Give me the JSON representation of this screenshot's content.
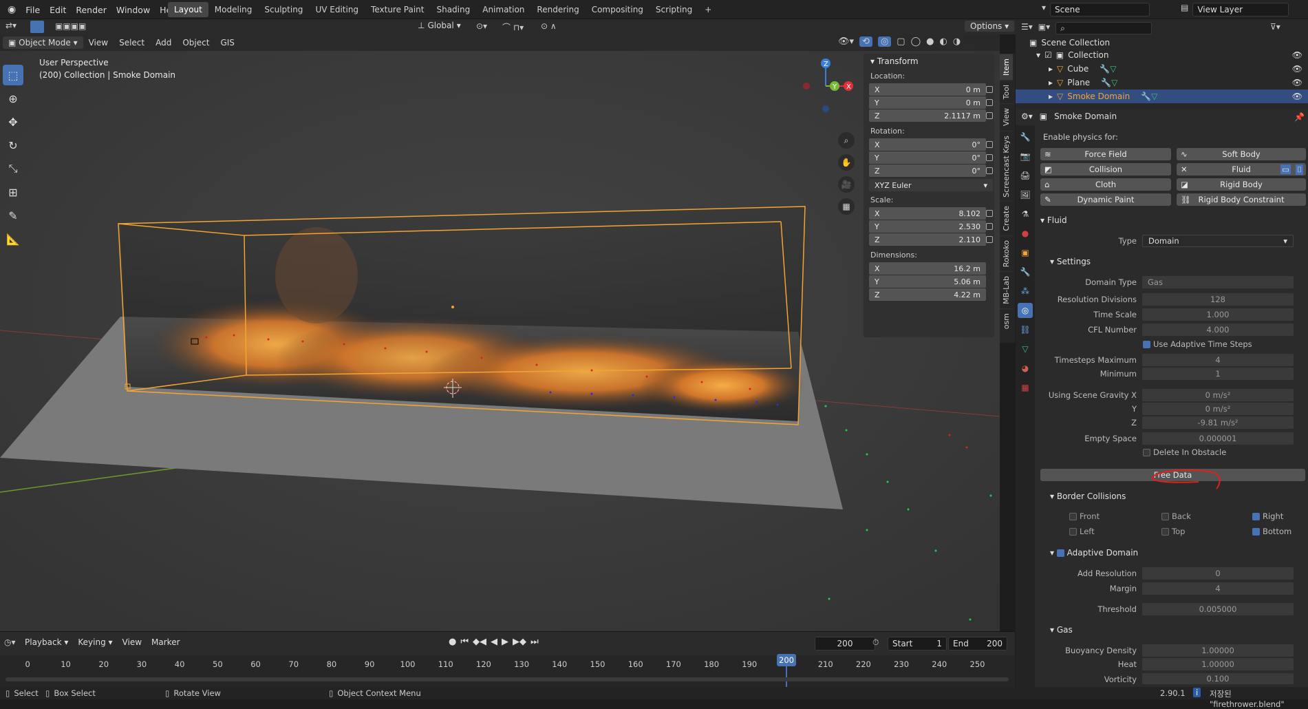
{
  "menu": {
    "file": "File",
    "edit": "Edit",
    "render": "Render",
    "window": "Window",
    "help": "Help"
  },
  "workspaces": [
    "Layout",
    "Modeling",
    "Sculpting",
    "UV Editing",
    "Texture Paint",
    "Shading",
    "Animation",
    "Rendering",
    "Compositing",
    "Scripting"
  ],
  "scene": {
    "name": "Scene",
    "view_layer": "View Layer"
  },
  "toolheader": {
    "orientation": "Global",
    "options": "Options"
  },
  "viewport_header": {
    "mode": "Object Mode",
    "view": "View",
    "select": "Select",
    "add": "Add",
    "object": "Object",
    "gis": "GIS"
  },
  "viewport": {
    "perspective": "User Perspective",
    "context": "(200) Collection | Smoke Domain"
  },
  "transform": {
    "title": "Transform",
    "location_label": "Location:",
    "loc_x": "0 m",
    "loc_y": "0 m",
    "loc_z": "2.1117 m",
    "rotation_label": "Rotation:",
    "rot_x": "0°",
    "rot_y": "0°",
    "rot_z": "0°",
    "rotation_mode": "XYZ Euler",
    "scale_label": "Scale:",
    "scale_x": "8.102",
    "scale_y": "2.530",
    "scale_z": "2.110",
    "dimensions_label": "Dimensions:",
    "dim_x": "16.2 m",
    "dim_y": "5.06 m",
    "dim_z": "4.22 m",
    "axis_x": "X",
    "axis_y": "Y",
    "axis_z": "Z"
  },
  "side_tabs": [
    "Item",
    "Tool",
    "View",
    "Screencast Keys",
    "Create",
    "Rokoko",
    "MB-Lab",
    "osm"
  ],
  "outliner": {
    "root": "Scene Collection",
    "collection": "Collection",
    "items": [
      "Cube",
      "Plane",
      "Smoke Domain"
    ]
  },
  "properties": {
    "object_name": "Smoke Domain",
    "enable_physics": "Enable physics for:",
    "physics_buttons": [
      "Force Field",
      "Soft Body",
      "Collision",
      "Fluid",
      "Cloth",
      "Rigid Body",
      "Dynamic Paint",
      "Rigid Body Constraint"
    ],
    "fluid_section": "Fluid",
    "type_label": "Type",
    "type_value": "Domain",
    "settings_section": "Settings",
    "domain_type_label": "Domain Type",
    "domain_type_value": "Gas",
    "res_label": "Resolution Divisions",
    "res_value": "128",
    "timescale_label": "Time Scale",
    "timescale_value": "1.000",
    "cfl_label": "CFL Number",
    "cfl_value": "4.000",
    "adaptive_steps": "Use Adaptive Time Steps",
    "ts_max_label": "Timesteps Maximum",
    "ts_max_value": "4",
    "ts_min_label": "Minimum",
    "ts_min_value": "1",
    "gravity_label": "Using Scene Gravity X",
    "gravity_x": "0 m/s²",
    "gravity_y_label": "Y",
    "gravity_y": "0 m/s²",
    "gravity_z_label": "Z",
    "gravity_z": "-9.81 m/s²",
    "empty_label": "Empty Space",
    "empty_value": "0.000001",
    "delete_obstacle": "Delete In Obstacle",
    "free_data": "Free Data",
    "border_section": "Border Collisions",
    "border": {
      "front": "Front",
      "back": "Back",
      "right": "Right",
      "left": "Left",
      "top": "Top",
      "bottom": "Bottom"
    },
    "adaptive_section": "Adaptive Domain",
    "add_res_label": "Add Resolution",
    "add_res_value": "0",
    "margin_label": "Margin",
    "margin_value": "4",
    "threshold_label": "Threshold",
    "threshold_value": "0.005000",
    "gas_section": "Gas",
    "buoyancy_label": "Buoyancy Density",
    "buoyancy_value": "1.00000",
    "heat_label": "Heat",
    "heat_value": "1.00000",
    "vorticity_label": "Vorticity",
    "vorticity_value": "0.100"
  },
  "timeline": {
    "playback": "Playback",
    "keying": "Keying",
    "view": "View",
    "marker": "Marker",
    "current_frame": "200",
    "start_label": "Start",
    "start": "1",
    "end_label": "End",
    "end": "200",
    "ticks": [
      "0",
      "10",
      "20",
      "30",
      "40",
      "50",
      "60",
      "70",
      "80",
      "90",
      "100",
      "110",
      "120",
      "130",
      "140",
      "150",
      "160",
      "170",
      "180",
      "190",
      "200",
      "210",
      "220",
      "230",
      "240",
      "250"
    ]
  },
  "status": {
    "select": "Select",
    "box_select": "Box Select",
    "rotate": "Rotate View",
    "context_menu": "Object Context Menu",
    "version": "2.90.1",
    "saved": "저장된 \"firethrower.blend\""
  },
  "colors": {
    "accent": "#4772b3",
    "orange": "#f5a432",
    "annotation": "#e0201e"
  }
}
